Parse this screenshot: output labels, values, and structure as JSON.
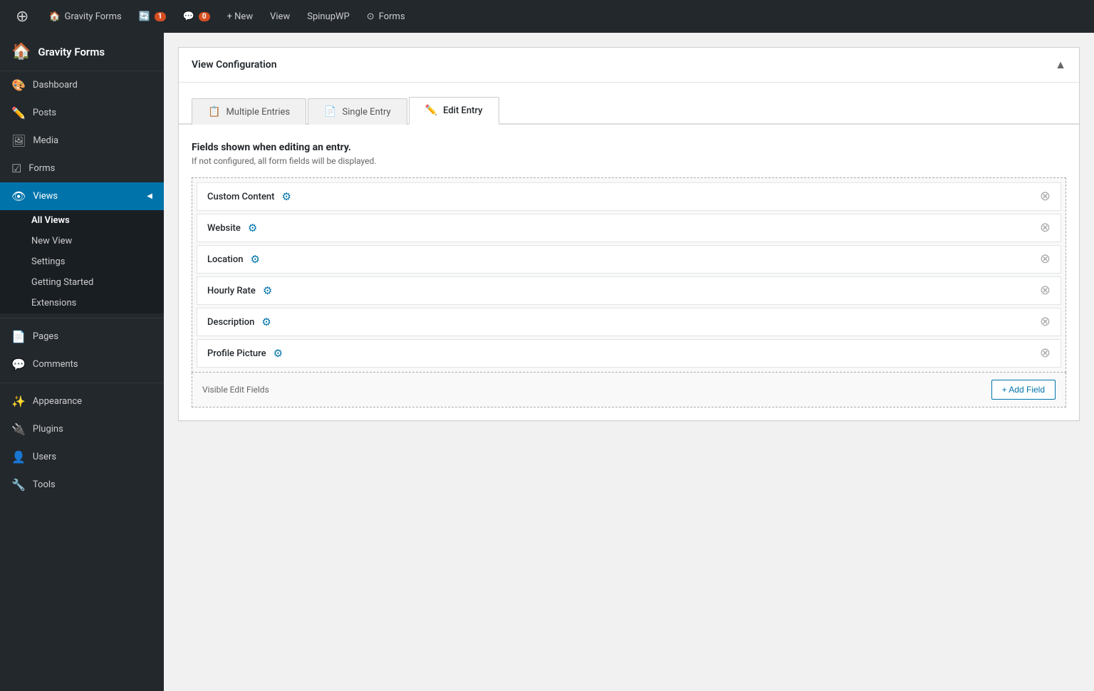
{
  "adminbar": {
    "wp_icon": "⊕",
    "site_name": "Gravity Forms",
    "updates_count": "1",
    "comments_count": "0",
    "new_label": "+ New",
    "view_label": "View",
    "spinupwp_label": "SpinupWP",
    "forms_label": "Forms"
  },
  "sidebar": {
    "header_icon": "🏠",
    "header_label": "Gravity Forms",
    "items": [
      {
        "id": "dashboard",
        "label": "Dashboard",
        "icon": "🎨"
      },
      {
        "id": "posts",
        "label": "Posts",
        "icon": "✏️"
      },
      {
        "id": "media",
        "label": "Media",
        "icon": "🖼"
      },
      {
        "id": "forms",
        "label": "Forms",
        "icon": "☑"
      },
      {
        "id": "views",
        "label": "Views",
        "icon": "👁",
        "active": true
      }
    ],
    "views_submenu": [
      {
        "id": "all-views",
        "label": "All Views",
        "active": true
      },
      {
        "id": "new-view",
        "label": "New View"
      },
      {
        "id": "settings",
        "label": "Settings"
      },
      {
        "id": "getting-started",
        "label": "Getting Started"
      },
      {
        "id": "extensions",
        "label": "Extensions"
      }
    ],
    "bottom_items": [
      {
        "id": "pages",
        "label": "Pages",
        "icon": "📄"
      },
      {
        "id": "comments",
        "label": "Comments",
        "icon": "💬"
      },
      {
        "id": "appearance",
        "label": "Appearance",
        "icon": "✨"
      },
      {
        "id": "plugins",
        "label": "Plugins",
        "icon": "🔌"
      },
      {
        "id": "users",
        "label": "Users",
        "icon": "👤"
      },
      {
        "id": "tools",
        "label": "Tools",
        "icon": "🔧"
      }
    ]
  },
  "panel": {
    "title": "View Configuration",
    "toggle_icon": "▲"
  },
  "tabs": [
    {
      "id": "multiple-entries",
      "label": "Multiple Entries",
      "icon": "📋",
      "active": false
    },
    {
      "id": "single-entry",
      "label": "Single Entry",
      "icon": "📄",
      "active": false
    },
    {
      "id": "edit-entry",
      "label": "Edit Entry",
      "icon": "✏️",
      "active": true
    }
  ],
  "fields_section": {
    "title": "Fields shown when editing an entry.",
    "subtitle": "If not configured, all form fields will be displayed.",
    "fields": [
      {
        "id": "custom-content",
        "label": "Custom Content"
      },
      {
        "id": "website",
        "label": "Website"
      },
      {
        "id": "location",
        "label": "Location"
      },
      {
        "id": "hourly-rate",
        "label": "Hourly Rate"
      },
      {
        "id": "description",
        "label": "Description"
      },
      {
        "id": "profile-picture",
        "label": "Profile Picture"
      }
    ],
    "footer_label": "Visible Edit Fields",
    "add_field_label": "+ Add Field"
  }
}
